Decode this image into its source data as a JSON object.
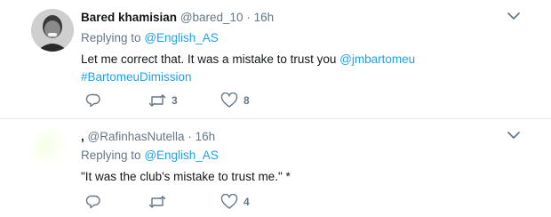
{
  "tweets": [
    {
      "author_name": "Bared khamisian",
      "author_handle": "@bared_10",
      "separator": "·",
      "time": "16h",
      "replying_prefix": "Replying to",
      "replying_to": "@English_AS",
      "text_main": "Let me correct that. It was a mistake to trust you",
      "mention": "@jmbartomeu",
      "hashtag": "#BartomeuDimission",
      "retweets": "3",
      "likes": "8"
    },
    {
      "author_name": ",",
      "author_handle": "@RafinhasNutella",
      "separator": "·",
      "time": "16h",
      "replying_prefix": "Replying to",
      "replying_to": "@English_AS",
      "text_main": "\"It was the club's mistake to trust me.\" *",
      "likes": "4"
    }
  ],
  "icons": {
    "reply": "reply-icon",
    "retweet": "retweet-icon",
    "like": "heart-icon",
    "menu": "chevron-down-icon"
  },
  "colors": {
    "link": "#1da1f2",
    "secondary_text": "#657786",
    "primary_text": "#14171a",
    "divider": "#e6ecf0"
  }
}
